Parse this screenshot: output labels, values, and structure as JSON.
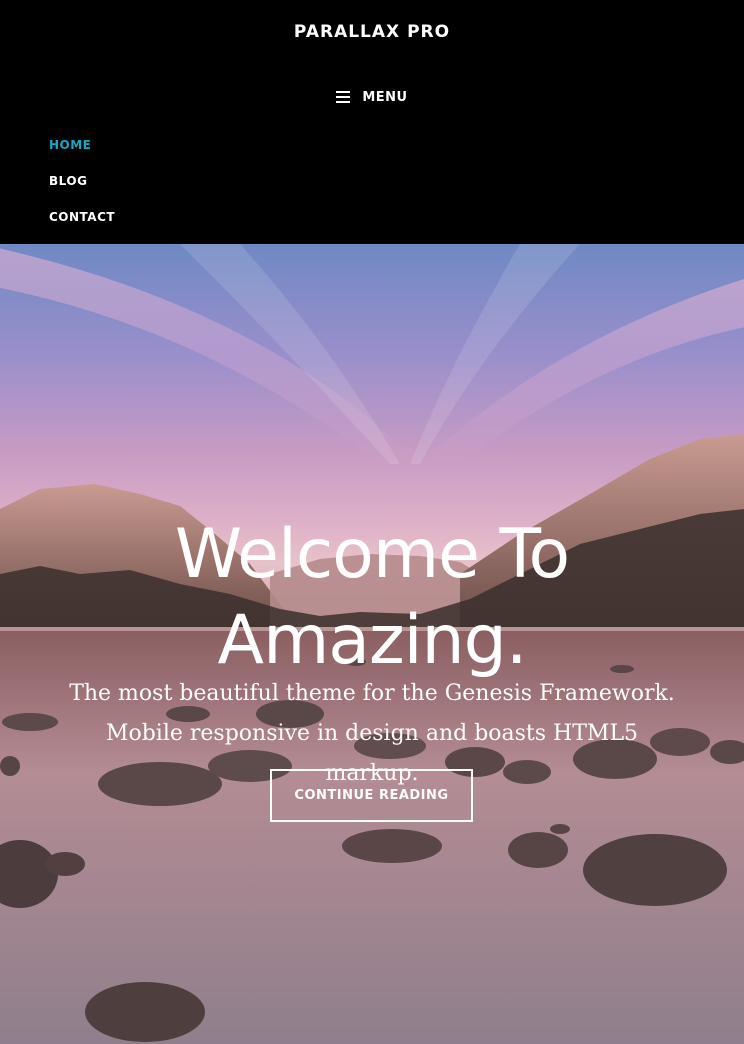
{
  "header": {
    "site_title": "PARALLAX PRO",
    "menu_label": "MENU",
    "menu_icon": "hamburger-icon",
    "nav_items": [
      {
        "label": "HOME",
        "current": true
      },
      {
        "label": "BLOG",
        "current": false
      },
      {
        "label": "CONTACT",
        "current": false
      }
    ]
  },
  "hero": {
    "title_line1": "Welcome To",
    "title_line2": "Amazing.",
    "text_line1": "The most beautiful theme for the Genesis Framework.",
    "text_line2": "Mobile responsive in design and boasts HTML5 markup.",
    "button_label": "CONTINUE READING"
  },
  "colors": {
    "header_bg": "#000000",
    "accent": "#16a8c4",
    "text": "#ffffff"
  }
}
